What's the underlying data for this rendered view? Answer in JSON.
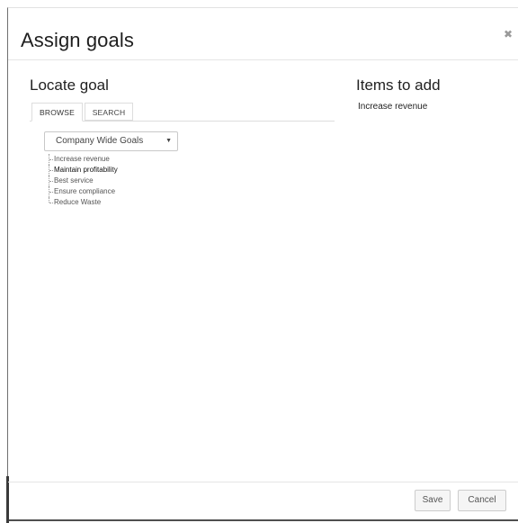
{
  "dialog": {
    "title": "Assign goals",
    "close_icon": "close-icon",
    "close_glyph": "✖"
  },
  "locate": {
    "title": "Locate goal",
    "tabs": [
      {
        "label": "BROWSE",
        "active": true
      },
      {
        "label": "SEARCH",
        "active": false
      }
    ],
    "select": {
      "selected": "Company Wide Goals",
      "arrow_icon": "chevron-down-icon",
      "arrow_glyph": "▼"
    },
    "tree": [
      {
        "label": "Increase revenue"
      },
      {
        "label": "Maintain profitability"
      },
      {
        "label": "Best service"
      },
      {
        "label": "Ensure compliance"
      },
      {
        "label": "Reduce Waste"
      }
    ]
  },
  "items_to_add": {
    "title": "Items to add",
    "items": [
      {
        "label": "Increase revenue"
      }
    ]
  },
  "footer": {
    "save_label": "Save",
    "cancel_label": "Cancel"
  }
}
